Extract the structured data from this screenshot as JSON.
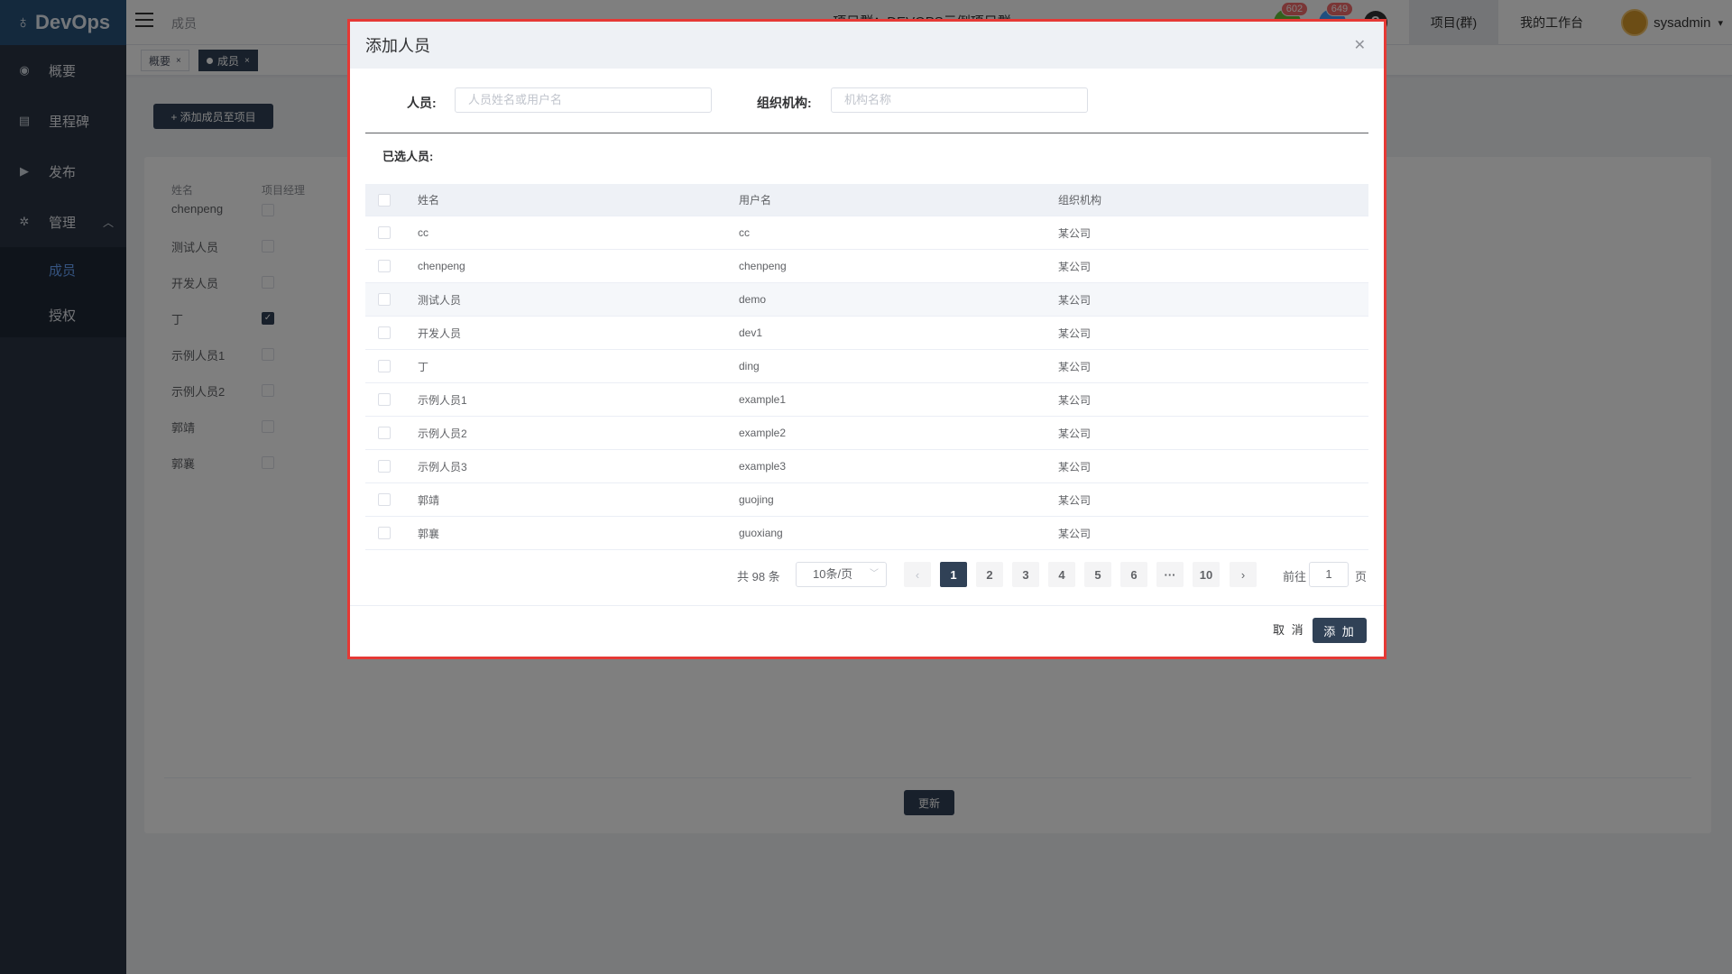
{
  "app": {
    "logo": "DevOps"
  },
  "sidebar": {
    "items": [
      {
        "label": "概要",
        "icon": "dashboard-icon"
      },
      {
        "label": "里程碑",
        "icon": "milestone-icon"
      },
      {
        "label": "发布",
        "icon": "release-icon"
      },
      {
        "label": "管理",
        "icon": "gear-icon"
      }
    ],
    "submenu": [
      {
        "label": "成员",
        "active": true
      },
      {
        "label": "授权",
        "active": false
      }
    ]
  },
  "header": {
    "breadcrumb": "成员",
    "title": "● 项目群：DEVOPS示例项目群 ●",
    "badge1": "602",
    "badge2": "649",
    "help": "?",
    "nav_projects": "项目(群)",
    "nav_workspace": "我的工作台",
    "username": "sysadmin"
  },
  "tags": {
    "tab1": "概要",
    "tab2": "成员"
  },
  "main": {
    "add_member_button": "+ 添加成员至项目",
    "col_name": "姓名",
    "col_pm": "项目经理",
    "members": [
      {
        "name": "chenpeng",
        "pm": false
      },
      {
        "name": "测试人员",
        "pm": false
      },
      {
        "name": "开发人员",
        "pm": false
      },
      {
        "name": "丁",
        "pm": true
      },
      {
        "name": "示例人员1",
        "pm": false
      },
      {
        "name": "示例人员2",
        "pm": false
      },
      {
        "name": "郭靖",
        "pm": false
      },
      {
        "name": "郭襄",
        "pm": false
      }
    ],
    "update_button": "更新"
  },
  "dialog": {
    "title": "添加人员",
    "person_label": "人员:",
    "person_placeholder": "人员姓名或用户名",
    "org_label": "组织机构:",
    "org_placeholder": "机构名称",
    "selected_label": "已选人员:",
    "columns": {
      "name": "姓名",
      "username": "用户名",
      "org": "组织机构"
    },
    "rows": [
      {
        "name": "cc",
        "username": "cc",
        "org": "某公司"
      },
      {
        "name": "chenpeng",
        "username": "chenpeng",
        "org": "某公司"
      },
      {
        "name": "测试人员",
        "username": "demo",
        "org": "某公司"
      },
      {
        "name": "开发人员",
        "username": "dev1",
        "org": "某公司"
      },
      {
        "name": "丁",
        "username": "ding",
        "org": "某公司"
      },
      {
        "name": "示例人员1",
        "username": "example1",
        "org": "某公司"
      },
      {
        "name": "示例人员2",
        "username": "example2",
        "org": "某公司"
      },
      {
        "name": "示例人员3",
        "username": "example3",
        "org": "某公司"
      },
      {
        "name": "郭靖",
        "username": "guojing",
        "org": "某公司"
      },
      {
        "name": "郭襄",
        "username": "guoxiang",
        "org": "某公司"
      }
    ],
    "pagination": {
      "total": "共 98 条",
      "page_size": "10条/页",
      "pages": [
        "1",
        "2",
        "3",
        "4",
        "5",
        "6",
        "···",
        "10"
      ],
      "current": "1",
      "goto_label": "前往",
      "goto_value": "1",
      "page_suffix": "页"
    },
    "cancel": "取 消",
    "confirm": "添 加"
  },
  "colors": {
    "sidebar": "#2b3544",
    "logo_bar": "#28527a",
    "primary": "#304156",
    "highlight_border": "#e53935"
  }
}
